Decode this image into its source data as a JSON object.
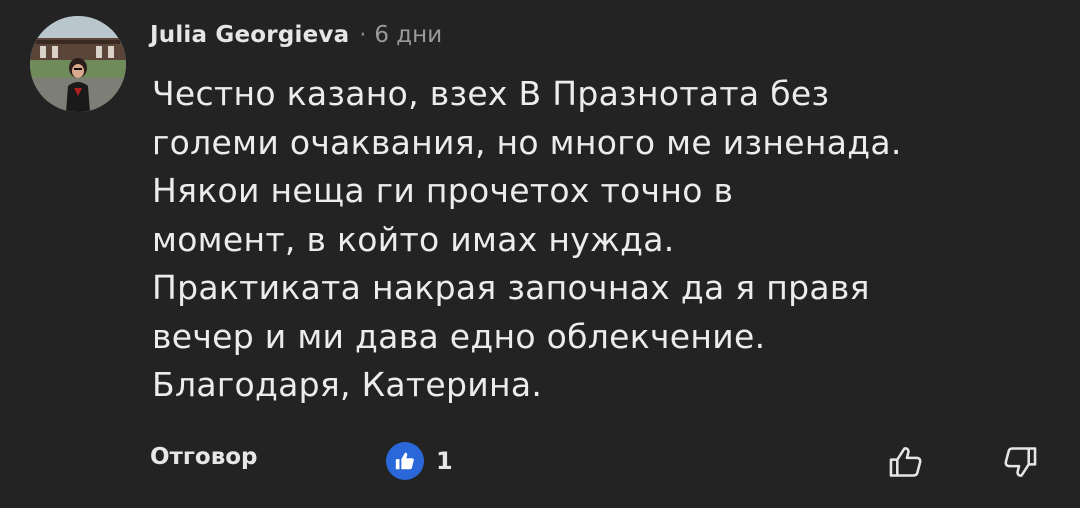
{
  "comment": {
    "author": "Julia Georgieva",
    "separator": "·",
    "time": "6 дни",
    "text": "Честно казано, взех В Празнотата без\nголеми очаквания, но много ме изненада.\nНякои неща ги прочетох точно в\nмомент, в който имах нужда.\nПрактиката накрая започнах да я правя\nвечер и ми дава едно облекчение.\nБлагодаря, Катерина.",
    "reply_label": "Отговор",
    "like_count": "1",
    "avatar_icon": "user-avatar-photo",
    "like_icon": "thumbs-up-icon",
    "upvote_icon": "thumbs-up-outline-icon",
    "downvote_icon": "thumbs-down-outline-icon"
  },
  "colors": {
    "background": "#232323",
    "like_badge": "#2a67d8",
    "text": "#ececec",
    "muted": "#9a9a9a"
  }
}
